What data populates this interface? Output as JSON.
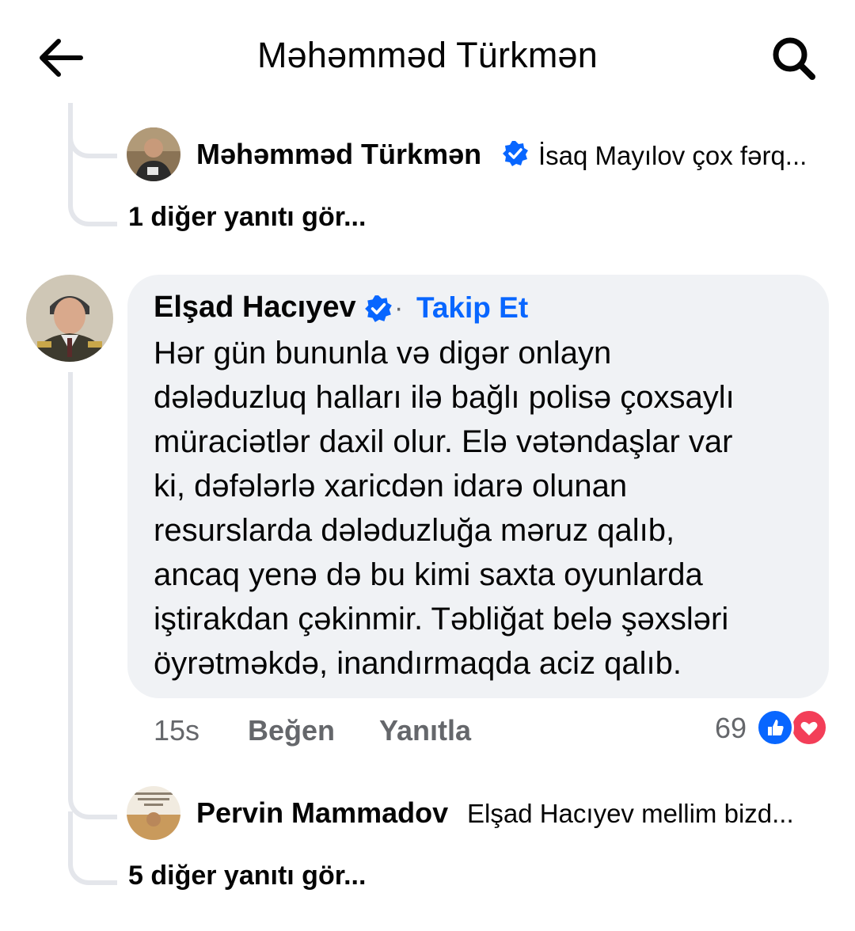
{
  "header": {
    "title": "Məhəmməd Türkmən"
  },
  "thread_top": {
    "reply": {
      "author": "Məhəmməd Türkmən",
      "preview": "İsaq Mayılov çox fərq...",
      "verified": true
    },
    "more_replies": "1 diğer yanıtı gör..."
  },
  "comment": {
    "author": "Elşad Hacıyev",
    "verified": true,
    "separator": "·",
    "follow_label": "Takip Et",
    "lines": [
      "Hər gün bununla və digər onlayn",
      "dələduzluq halları ilə bağlı polisə çoxsaylı",
      "müraciətlər daxil olur. Elə vətəndaşlar var",
      "ki, dəfələrlə xaricdən idarə olunan",
      "resurslarda dələduzluğa məruz qalıb,",
      "ancaq yenə də bu kimi saxta oyunlarda",
      "iştirakdan çəkinmir. Təbliğat belə şəxsləri",
      "öyrətməkdə, inandırmaqda aciz qalıb."
    ],
    "time": "15s",
    "like_label": "Beğen",
    "reply_label": "Yanıtla",
    "reaction_count": "69",
    "reactions": [
      "like-icon",
      "love-icon"
    ]
  },
  "thread_bottom": {
    "reply": {
      "author": "Pervin Mammadov",
      "preview": "Elşad Hacıyev mellim bizd..."
    },
    "more_replies": "5 diğer yanıtı gör..."
  },
  "colors": {
    "accent": "#0866ff",
    "bubble": "#f0f2f5",
    "muted": "#65676b",
    "love": "#f33e58",
    "thread_line": "#e4e6eb"
  }
}
